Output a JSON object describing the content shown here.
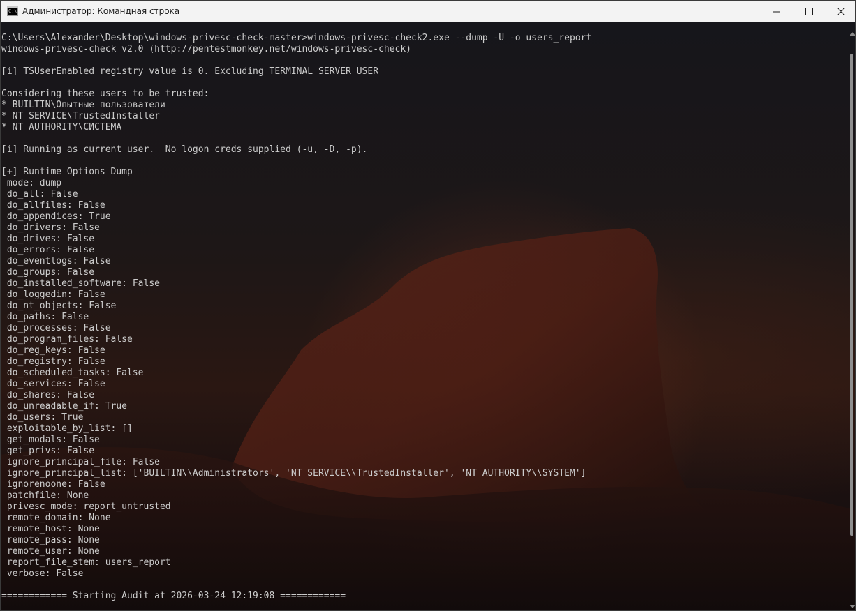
{
  "window": {
    "title": "Администратор: Командная строка",
    "icon_text": "C:\\",
    "controls": [
      "minimize-icon",
      "maximize-icon",
      "close-icon"
    ]
  },
  "terminal": {
    "lines": [
      "C:\\Users\\Alexander\\Desktop\\windows-privesc-check-master>windows-privesc-check2.exe --dump -U -o users_report",
      "windows-privesc-check v2.0 (http://pentestmonkey.net/windows-privesc-check)",
      "",
      "[i] TSUserEnabled registry value is 0. Excluding TERMINAL SERVER USER",
      "",
      "Considering these users to be trusted:",
      "* BUILTIN\\Опытные пользователи",
      "* NT SERVICE\\TrustedInstaller",
      "* NT AUTHORITY\\СИСТЕМА",
      "",
      "[i] Running as current user.  No logon creds supplied (-u, -D, -p).",
      "",
      "[+] Runtime Options Dump",
      " mode: dump",
      " do_all: False",
      " do_allfiles: False",
      " do_appendices: True",
      " do_drivers: False",
      " do_drives: False",
      " do_errors: False",
      " do_eventlogs: False",
      " do_groups: False",
      " do_installed_software: False",
      " do_loggedin: False",
      " do_nt_objects: False",
      " do_paths: False",
      " do_processes: False",
      " do_program_files: False",
      " do_reg_keys: False",
      " do_registry: False",
      " do_scheduled_tasks: False",
      " do_services: False",
      " do_shares: False",
      " do_unreadable_if: True",
      " do_users: True",
      " exploitable_by_list: []",
      " get_modals: False",
      " get_privs: False",
      " ignore_principal_file: False",
      " ignore_principal_list: ['BUILTIN\\\\Administrators', 'NT SERVICE\\\\TrustedInstaller', 'NT AUTHORITY\\\\SYSTEM']",
      " ignorenoone: False",
      " patchfile: None",
      " privesc_mode: report_untrusted",
      " remote_domain: None",
      " remote_host: None",
      " remote_pass: None",
      " remote_user: None",
      " report_file_stem: users_report",
      " verbose: False",
      "",
      "============ Starting Audit at 2026-03-24 12:19:08 ============"
    ]
  },
  "scrollbar": {
    "thumb_start_fraction": 0.03,
    "thumb_end_fraction": 0.88
  },
  "colors": {
    "text": "#cccccc",
    "titlebar": "#f3f3f3",
    "terminal_bg": "#1a1716"
  }
}
